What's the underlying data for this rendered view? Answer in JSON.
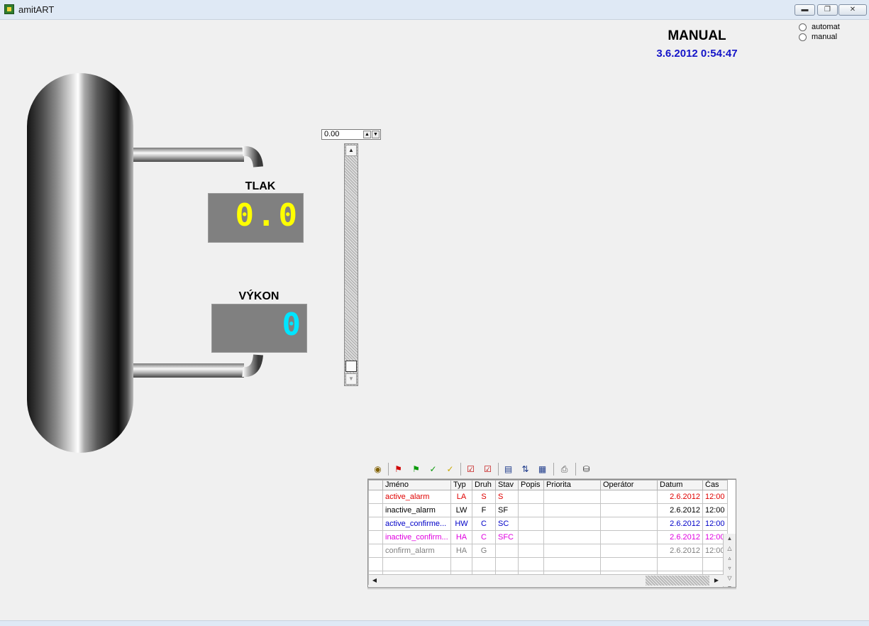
{
  "window": {
    "title": "amitART",
    "icons": {
      "app": "app-icon",
      "minimize": "minimize-icon",
      "restore": "restore-icon",
      "close": "close-icon"
    }
  },
  "header": {
    "mode": "MANUAL",
    "datetime": "3.6.2012 0:54:47"
  },
  "mode_selector": {
    "options": [
      {
        "label": "automat",
        "selected": false
      },
      {
        "label": "manual",
        "selected": false
      }
    ]
  },
  "gauges": {
    "tlak": {
      "label": "TLAK",
      "value": "0.0",
      "color": "#ffff00"
    },
    "vykon": {
      "label": "VÝKON",
      "value": "0",
      "color": "#00e5ff"
    }
  },
  "setpoint": {
    "value": "0.00",
    "slider_fraction": 0.0
  },
  "alarm_toolbar": {
    "buttons": [
      "binoculars-icon",
      "flag-red-check-icon",
      "flag-green-icon",
      "flag-green-check-icon",
      "flag-yellow-check-icon",
      "checkbox-check-icon",
      "checkbox-double-check-icon",
      "window-icon",
      "sort-z-a-icon",
      "table-arrow-icon",
      "printer-icon",
      "lock-icon"
    ]
  },
  "alarm_table": {
    "columns": [
      "Jméno",
      "Typ",
      "Druh",
      "Stav",
      "Popis",
      "Priorita",
      "Operátor",
      "Datum",
      "Čas"
    ],
    "rows": [
      {
        "cells": [
          "active_alarm",
          "LA",
          "S",
          "S",
          "",
          "",
          "",
          "2.6.2012",
          "12:00"
        ],
        "color": "#e00000",
        "datum_color": "#e00000",
        "cas_color": "#e00000"
      },
      {
        "cells": [
          "inactive_alarm",
          "LW",
          "F",
          "SF",
          "",
          "",
          "",
          "2.6.2012",
          "12:00"
        ],
        "color": "#000000",
        "datum_color": "#000000",
        "cas_color": "#000000"
      },
      {
        "cells": [
          "active_confirme...",
          "HW",
          "C",
          "SC",
          "",
          "",
          "",
          "2.6.2012",
          "12:00"
        ],
        "color": "#0000c8",
        "datum_color": "#0000c8",
        "cas_color": "#0000c8"
      },
      {
        "cells": [
          "inactive_confirm...",
          "HA",
          "C",
          "SFC",
          "",
          "",
          "",
          "2.6.2012",
          "12:00"
        ],
        "color": "#e000e0",
        "datum_color": "#e000e0",
        "cas_color": "#e000e0"
      },
      {
        "cells": [
          "confirm_alarm",
          "HA",
          "G",
          "",
          "",
          "",
          "",
          "2.6.2012",
          "12:00"
        ],
        "color": "#808080",
        "datum_color": "#808080",
        "cas_color": "#808080"
      }
    ],
    "empty_rows": 2
  }
}
